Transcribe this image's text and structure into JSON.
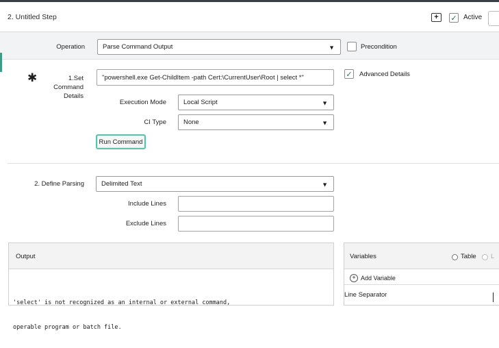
{
  "header": {
    "step_title": "2. Untitled Step",
    "active_label": "Active",
    "active_checked": true
  },
  "operation": {
    "label": "Operation",
    "value": "Parse Command Output",
    "precondition_label": "Precondition",
    "precondition_checked": false
  },
  "command": {
    "label_line1": "1.Set Command",
    "label_line2": "Details",
    "value": "\"powershell.exe Get-ChildItem -path  Cert:\\CurrentUser\\Root | select *\"",
    "advanced_label": "Advanced Details",
    "advanced_checked": true,
    "execution_mode_label": "Execution Mode",
    "execution_mode_value": "Local Script",
    "ci_type_label": "CI Type",
    "ci_type_value": "None",
    "run_button": "Run Command"
  },
  "parsing": {
    "label": "2. Define Parsing",
    "value": "Delimited Text",
    "include_label": "Include Lines",
    "include_value": "",
    "exclude_label": "Exclude Lines",
    "exclude_value": ""
  },
  "output": {
    "title": "Output",
    "line1": "'select' is not recognized as an internal or external command,",
    "line2": "operable program or batch file."
  },
  "variables": {
    "title": "Variables",
    "table_label": "Table",
    "second_option": "L",
    "add_label": "Add Variable",
    "line_separator_label": "Line Separator"
  },
  "colors": {
    "accent": "#3e9b86",
    "focus_ring": "#5fc0ad",
    "topbar": "#3a3f45"
  }
}
